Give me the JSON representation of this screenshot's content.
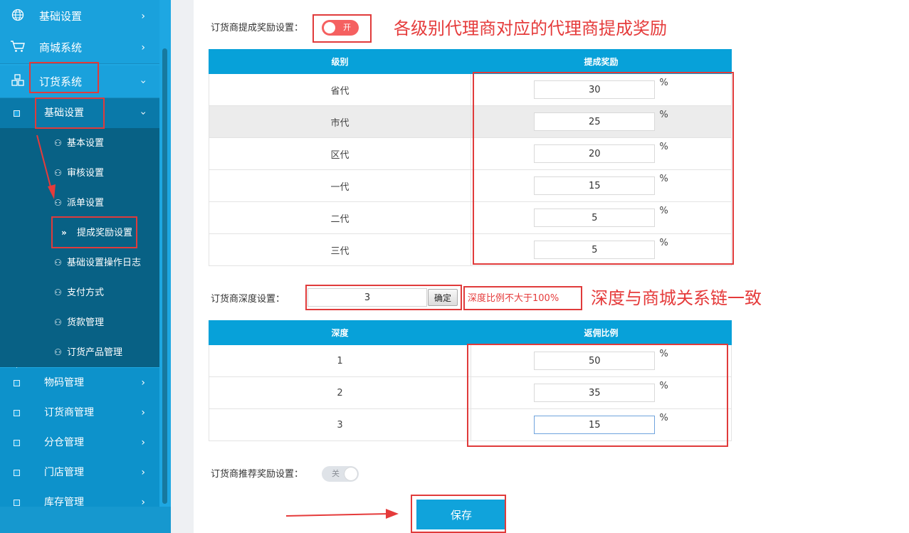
{
  "sidebar": {
    "top_items": [
      {
        "label": "基础设置",
        "icon": "globe-icon"
      },
      {
        "label": "商城系统",
        "icon": "cart-icon"
      },
      {
        "label": "订货系统",
        "icon": "cubes-icon"
      }
    ],
    "sub_header": "基础设置",
    "sub_items": [
      {
        "label": "基本设置",
        "icon": "user-icon"
      },
      {
        "label": "审核设置",
        "icon": "user-icon"
      },
      {
        "label": "派单设置",
        "icon": "user-icon"
      },
      {
        "label": "提成奖励设置",
        "icon": "double-chevron-icon"
      },
      {
        "label": "基础设置操作日志",
        "icon": "user-icon"
      },
      {
        "label": "支付方式",
        "icon": "user-icon"
      },
      {
        "label": "货款管理",
        "icon": "user-icon"
      },
      {
        "label": "订货产品管理",
        "icon": "user-icon"
      }
    ],
    "bottom_items": [
      {
        "label": "物码管理"
      },
      {
        "label": "订货商管理"
      },
      {
        "label": "分仓管理"
      },
      {
        "label": "门店管理"
      },
      {
        "label": "库存管理"
      }
    ]
  },
  "commission": {
    "label": "订货商提成奖励设置：",
    "toggle_text": "开",
    "note": "各级别代理商对应的代理商提成奖励",
    "columns": [
      "级别",
      "提成奖励"
    ],
    "rows": [
      {
        "level": "省代",
        "value": "30"
      },
      {
        "level": "市代",
        "value": "25"
      },
      {
        "level": "区代",
        "value": "20"
      },
      {
        "level": "一代",
        "value": "15"
      },
      {
        "level": "二代",
        "value": "5"
      },
      {
        "level": "三代",
        "value": "5"
      }
    ],
    "unit": "%"
  },
  "depth": {
    "label": "订货商深度设置：",
    "value": "3",
    "confirm_label": "确定",
    "hint": "深度比例不大于100%",
    "note": "深度与商城关系链一致",
    "columns": [
      "深度",
      "返佣比例"
    ],
    "rows": [
      {
        "depth": "1",
        "value": "50"
      },
      {
        "depth": "2",
        "value": "35"
      },
      {
        "depth": "3",
        "value": "15"
      }
    ],
    "unit": "%"
  },
  "recommend": {
    "label": "订货商推荐奖励设置：",
    "toggle_text": "关"
  },
  "save_label": "保存",
  "colors": {
    "accent": "#07a1d9",
    "annotation_red": "#e53b3b",
    "toggle_on": "#f56060"
  }
}
